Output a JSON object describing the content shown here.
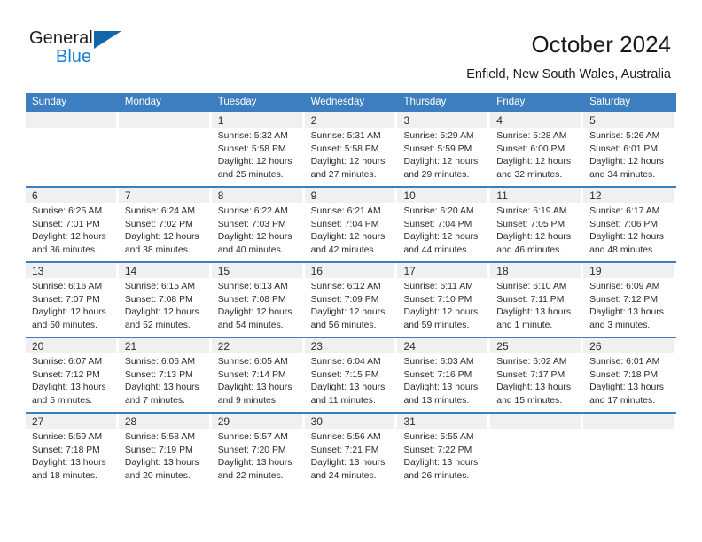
{
  "brand": {
    "name_part1": "General",
    "name_part2": "Blue",
    "accent_color": "#1b7fd4",
    "triangle_color": "#1266ab"
  },
  "header": {
    "title": "October 2024",
    "subtitle": "Enfield, New South Wales, Australia"
  },
  "theme": {
    "header_blue": "#3c7ebf",
    "band_gray": "#f0f0f0"
  },
  "weekdays": [
    "Sunday",
    "Monday",
    "Tuesday",
    "Wednesday",
    "Thursday",
    "Friday",
    "Saturday"
  ],
  "weeks": [
    [
      {
        "day": "",
        "lines": []
      },
      {
        "day": "",
        "lines": []
      },
      {
        "day": "1",
        "lines": [
          "Sunrise: 5:32 AM",
          "Sunset: 5:58 PM",
          "Daylight: 12 hours",
          "and 25 minutes."
        ]
      },
      {
        "day": "2",
        "lines": [
          "Sunrise: 5:31 AM",
          "Sunset: 5:58 PM",
          "Daylight: 12 hours",
          "and 27 minutes."
        ]
      },
      {
        "day": "3",
        "lines": [
          "Sunrise: 5:29 AM",
          "Sunset: 5:59 PM",
          "Daylight: 12 hours",
          "and 29 minutes."
        ]
      },
      {
        "day": "4",
        "lines": [
          "Sunrise: 5:28 AM",
          "Sunset: 6:00 PM",
          "Daylight: 12 hours",
          "and 32 minutes."
        ]
      },
      {
        "day": "5",
        "lines": [
          "Sunrise: 5:26 AM",
          "Sunset: 6:01 PM",
          "Daylight: 12 hours",
          "and 34 minutes."
        ]
      }
    ],
    [
      {
        "day": "6",
        "lines": [
          "Sunrise: 6:25 AM",
          "Sunset: 7:01 PM",
          "Daylight: 12 hours",
          "and 36 minutes."
        ]
      },
      {
        "day": "7",
        "lines": [
          "Sunrise: 6:24 AM",
          "Sunset: 7:02 PM",
          "Daylight: 12 hours",
          "and 38 minutes."
        ]
      },
      {
        "day": "8",
        "lines": [
          "Sunrise: 6:22 AM",
          "Sunset: 7:03 PM",
          "Daylight: 12 hours",
          "and 40 minutes."
        ]
      },
      {
        "day": "9",
        "lines": [
          "Sunrise: 6:21 AM",
          "Sunset: 7:04 PM",
          "Daylight: 12 hours",
          "and 42 minutes."
        ]
      },
      {
        "day": "10",
        "lines": [
          "Sunrise: 6:20 AM",
          "Sunset: 7:04 PM",
          "Daylight: 12 hours",
          "and 44 minutes."
        ]
      },
      {
        "day": "11",
        "lines": [
          "Sunrise: 6:19 AM",
          "Sunset: 7:05 PM",
          "Daylight: 12 hours",
          "and 46 minutes."
        ]
      },
      {
        "day": "12",
        "lines": [
          "Sunrise: 6:17 AM",
          "Sunset: 7:06 PM",
          "Daylight: 12 hours",
          "and 48 minutes."
        ]
      }
    ],
    [
      {
        "day": "13",
        "lines": [
          "Sunrise: 6:16 AM",
          "Sunset: 7:07 PM",
          "Daylight: 12 hours",
          "and 50 minutes."
        ]
      },
      {
        "day": "14",
        "lines": [
          "Sunrise: 6:15 AM",
          "Sunset: 7:08 PM",
          "Daylight: 12 hours",
          "and 52 minutes."
        ]
      },
      {
        "day": "15",
        "lines": [
          "Sunrise: 6:13 AM",
          "Sunset: 7:08 PM",
          "Daylight: 12 hours",
          "and 54 minutes."
        ]
      },
      {
        "day": "16",
        "lines": [
          "Sunrise: 6:12 AM",
          "Sunset: 7:09 PM",
          "Daylight: 12 hours",
          "and 56 minutes."
        ]
      },
      {
        "day": "17",
        "lines": [
          "Sunrise: 6:11 AM",
          "Sunset: 7:10 PM",
          "Daylight: 12 hours",
          "and 59 minutes."
        ]
      },
      {
        "day": "18",
        "lines": [
          "Sunrise: 6:10 AM",
          "Sunset: 7:11 PM",
          "Daylight: 13 hours",
          "and 1 minute."
        ]
      },
      {
        "day": "19",
        "lines": [
          "Sunrise: 6:09 AM",
          "Sunset: 7:12 PM",
          "Daylight: 13 hours",
          "and 3 minutes."
        ]
      }
    ],
    [
      {
        "day": "20",
        "lines": [
          "Sunrise: 6:07 AM",
          "Sunset: 7:12 PM",
          "Daylight: 13 hours",
          "and 5 minutes."
        ]
      },
      {
        "day": "21",
        "lines": [
          "Sunrise: 6:06 AM",
          "Sunset: 7:13 PM",
          "Daylight: 13 hours",
          "and 7 minutes."
        ]
      },
      {
        "day": "22",
        "lines": [
          "Sunrise: 6:05 AM",
          "Sunset: 7:14 PM",
          "Daylight: 13 hours",
          "and 9 minutes."
        ]
      },
      {
        "day": "23",
        "lines": [
          "Sunrise: 6:04 AM",
          "Sunset: 7:15 PM",
          "Daylight: 13 hours",
          "and 11 minutes."
        ]
      },
      {
        "day": "24",
        "lines": [
          "Sunrise: 6:03 AM",
          "Sunset: 7:16 PM",
          "Daylight: 13 hours",
          "and 13 minutes."
        ]
      },
      {
        "day": "25",
        "lines": [
          "Sunrise: 6:02 AM",
          "Sunset: 7:17 PM",
          "Daylight: 13 hours",
          "and 15 minutes."
        ]
      },
      {
        "day": "26",
        "lines": [
          "Sunrise: 6:01 AM",
          "Sunset: 7:18 PM",
          "Daylight: 13 hours",
          "and 17 minutes."
        ]
      }
    ],
    [
      {
        "day": "27",
        "lines": [
          "Sunrise: 5:59 AM",
          "Sunset: 7:18 PM",
          "Daylight: 13 hours",
          "and 18 minutes."
        ]
      },
      {
        "day": "28",
        "lines": [
          "Sunrise: 5:58 AM",
          "Sunset: 7:19 PM",
          "Daylight: 13 hours",
          "and 20 minutes."
        ]
      },
      {
        "day": "29",
        "lines": [
          "Sunrise: 5:57 AM",
          "Sunset: 7:20 PM",
          "Daylight: 13 hours",
          "and 22 minutes."
        ]
      },
      {
        "day": "30",
        "lines": [
          "Sunrise: 5:56 AM",
          "Sunset: 7:21 PM",
          "Daylight: 13 hours",
          "and 24 minutes."
        ]
      },
      {
        "day": "31",
        "lines": [
          "Sunrise: 5:55 AM",
          "Sunset: 7:22 PM",
          "Daylight: 13 hours",
          "and 26 minutes."
        ]
      },
      {
        "day": "",
        "lines": []
      },
      {
        "day": "",
        "lines": []
      }
    ]
  ]
}
